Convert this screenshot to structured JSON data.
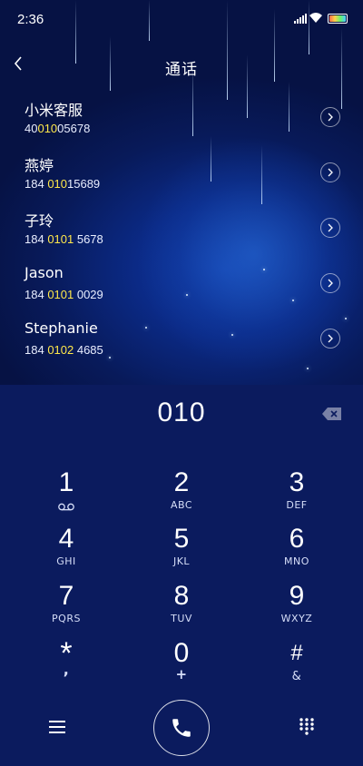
{
  "status": {
    "time": "2:36"
  },
  "header": {
    "title": "通话"
  },
  "contacts": [
    {
      "name": "小米客服",
      "num_pre": "40",
      "num_hl": "010",
      "num_post": "05678"
    },
    {
      "name": "燕婷",
      "num_pre": "184 ",
      "num_hl": "010",
      "num_post": "15689"
    },
    {
      "name": "子玲",
      "num_pre": "184 ",
      "num_hl": "0101",
      "num_post": " 5678"
    },
    {
      "name": "Jason",
      "num_pre": "184 ",
      "num_hl": "0101",
      "num_post": " 0029"
    },
    {
      "name": "Stephanie",
      "num_pre": "184 ",
      "num_hl": "0102",
      "num_post": " 4685"
    }
  ],
  "dialer": {
    "input": "010",
    "keys": [
      {
        "d": "1",
        "l": ""
      },
      {
        "d": "2",
        "l": "ABC"
      },
      {
        "d": "3",
        "l": "DEF"
      },
      {
        "d": "4",
        "l": "GHI"
      },
      {
        "d": "5",
        "l": "JKL"
      },
      {
        "d": "6",
        "l": "MNO"
      },
      {
        "d": "7",
        "l": "PQRS"
      },
      {
        "d": "8",
        "l": "TUV"
      },
      {
        "d": "9",
        "l": "WXYZ"
      },
      {
        "d": "*",
        "l": ","
      },
      {
        "d": "0",
        "l": "+"
      },
      {
        "d": "#",
        "l": "&"
      }
    ]
  },
  "icons": {
    "back": "chevron-left-icon",
    "arrow": "chevron-right-circle-icon",
    "voicemail": "voicemail-icon",
    "delete": "backspace-icon",
    "menu": "menu-icon",
    "call": "phone-icon",
    "keypad": "keypad-icon"
  },
  "colors": {
    "highlight": "#ffe84a",
    "background": "#0b1b5e"
  }
}
